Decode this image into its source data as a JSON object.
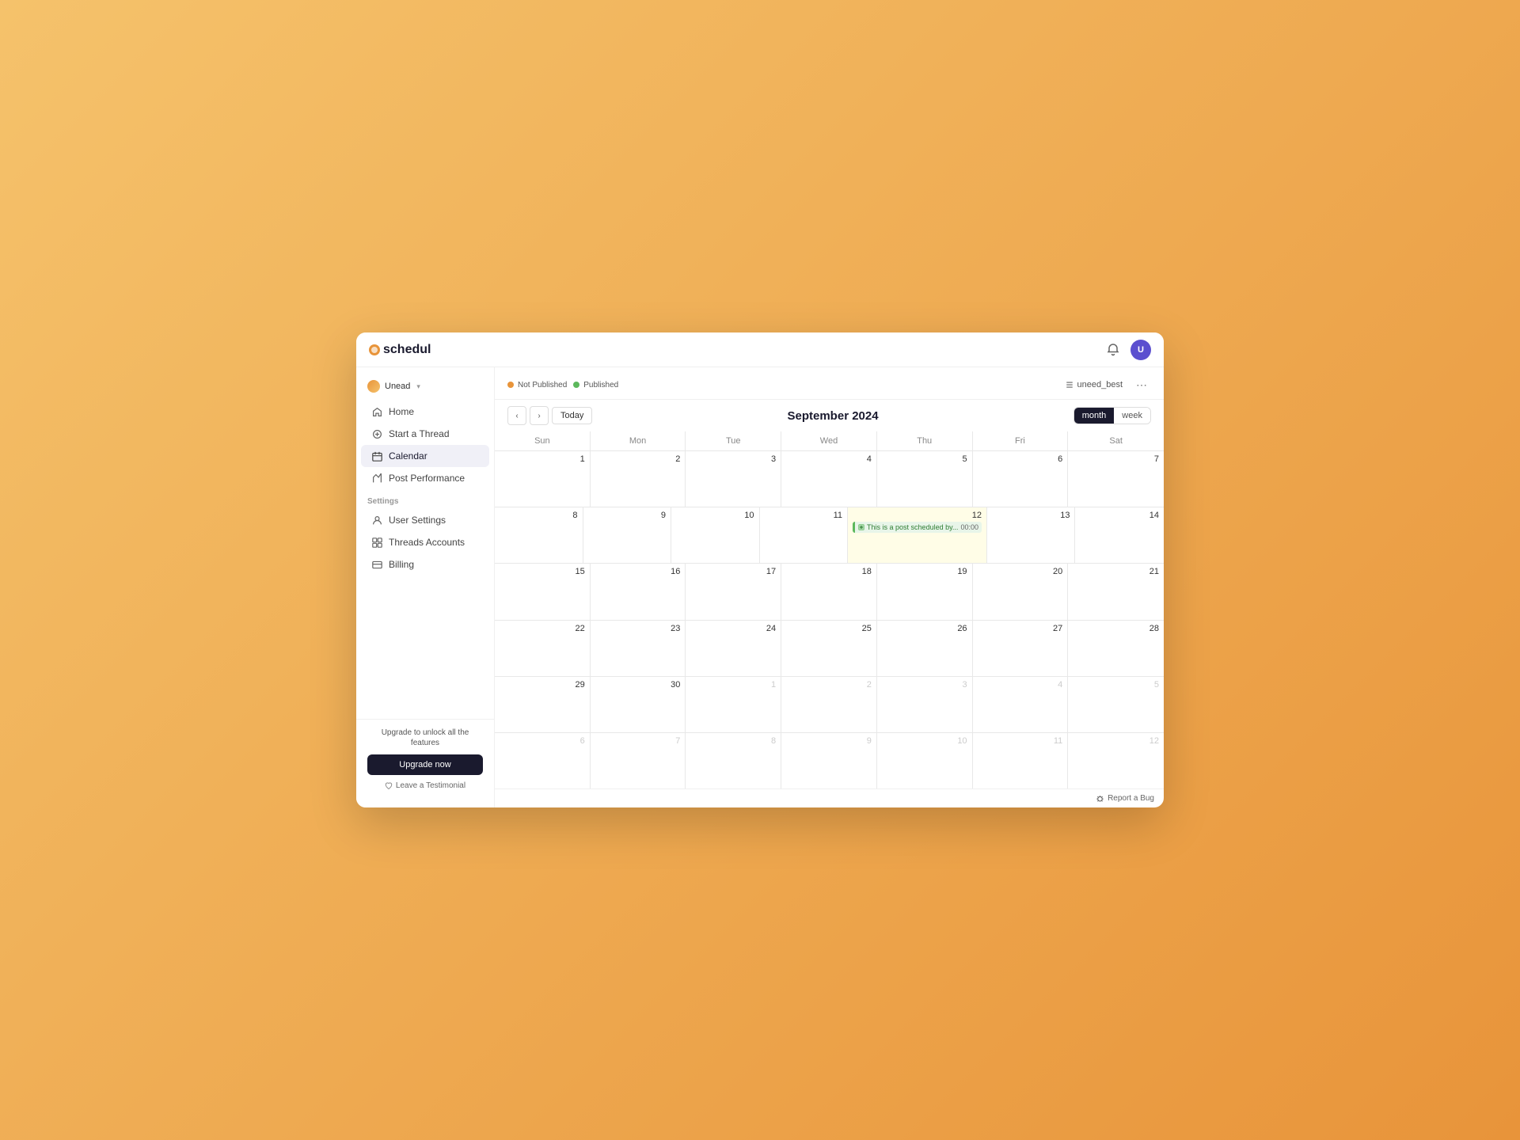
{
  "app": {
    "logo": "schedul",
    "logo_symbol": "©"
  },
  "topbar": {
    "bell_label": "🔔",
    "avatar_initials": "U"
  },
  "sidebar": {
    "account": {
      "name": "Unead",
      "dropdown": true
    },
    "nav_items": [
      {
        "id": "home",
        "label": "Home",
        "icon": "home"
      },
      {
        "id": "start-thread",
        "label": "Start a Thread",
        "icon": "plus"
      },
      {
        "id": "calendar",
        "label": "Calendar",
        "icon": "calendar",
        "active": true
      },
      {
        "id": "post-performance",
        "label": "Post Performance",
        "icon": "chart"
      }
    ],
    "settings_label": "Settings",
    "settings_items": [
      {
        "id": "user-settings",
        "label": "User Settings",
        "icon": "user"
      },
      {
        "id": "threads-accounts",
        "label": "Threads Accounts",
        "icon": "grid"
      },
      {
        "id": "billing",
        "label": "Billing",
        "icon": "credit-card"
      }
    ],
    "upgrade": {
      "text": "Upgrade to unlock all the features",
      "button_label": "Upgrade now"
    },
    "testimonial_label": "Leave a Testimonial"
  },
  "calendar": {
    "legend": {
      "not_published_label": "Not Published",
      "published_label": "Published"
    },
    "nav": {
      "prev_label": "‹",
      "next_label": "›",
      "today_label": "Today"
    },
    "title": "September 2024",
    "account_selector": "uneed_best",
    "view_buttons": [
      {
        "id": "month",
        "label": "month",
        "active": true
      },
      {
        "id": "week",
        "label": "week",
        "active": false
      }
    ],
    "weekdays": [
      "Sun",
      "Mon",
      "Tue",
      "Wed",
      "Thu",
      "Fri",
      "Sat"
    ],
    "weeks": [
      {
        "days": [
          {
            "num": "1",
            "other": false,
            "today": false,
            "highlighted": false,
            "events": []
          },
          {
            "num": "2",
            "other": false,
            "today": false,
            "highlighted": false,
            "events": []
          },
          {
            "num": "3",
            "other": false,
            "today": false,
            "highlighted": false,
            "events": []
          },
          {
            "num": "4",
            "other": false,
            "today": false,
            "highlighted": false,
            "events": []
          },
          {
            "num": "5",
            "other": false,
            "today": false,
            "highlighted": false,
            "events": []
          },
          {
            "num": "6",
            "other": false,
            "today": false,
            "highlighted": false,
            "events": []
          },
          {
            "num": "7",
            "other": false,
            "today": false,
            "highlighted": false,
            "events": []
          }
        ]
      },
      {
        "days": [
          {
            "num": "8",
            "other": false,
            "today": false,
            "highlighted": false,
            "events": []
          },
          {
            "num": "9",
            "other": false,
            "today": false,
            "highlighted": false,
            "events": []
          },
          {
            "num": "10",
            "other": false,
            "today": false,
            "highlighted": false,
            "events": []
          },
          {
            "num": "11",
            "other": false,
            "today": false,
            "highlighted": false,
            "events": []
          },
          {
            "num": "12",
            "other": false,
            "today": false,
            "highlighted": true,
            "events": [
              {
                "label": "This is a post scheduled by...",
                "time": "00:00",
                "type": "published"
              }
            ]
          },
          {
            "num": "13",
            "other": false,
            "today": false,
            "highlighted": false,
            "events": []
          },
          {
            "num": "14",
            "other": false,
            "today": false,
            "highlighted": false,
            "events": []
          }
        ]
      },
      {
        "days": [
          {
            "num": "15",
            "other": false,
            "today": false,
            "highlighted": false,
            "events": []
          },
          {
            "num": "16",
            "other": false,
            "today": false,
            "highlighted": false,
            "events": []
          },
          {
            "num": "17",
            "other": false,
            "today": false,
            "highlighted": false,
            "events": []
          },
          {
            "num": "18",
            "other": false,
            "today": false,
            "highlighted": false,
            "events": []
          },
          {
            "num": "19",
            "other": false,
            "today": false,
            "highlighted": false,
            "events": []
          },
          {
            "num": "20",
            "other": false,
            "today": false,
            "highlighted": false,
            "events": []
          },
          {
            "num": "21",
            "other": false,
            "today": false,
            "highlighted": false,
            "events": []
          }
        ]
      },
      {
        "days": [
          {
            "num": "22",
            "other": false,
            "today": false,
            "highlighted": false,
            "events": []
          },
          {
            "num": "23",
            "other": false,
            "today": false,
            "highlighted": false,
            "events": []
          },
          {
            "num": "24",
            "other": false,
            "today": false,
            "highlighted": false,
            "events": []
          },
          {
            "num": "25",
            "other": false,
            "today": false,
            "highlighted": false,
            "events": []
          },
          {
            "num": "26",
            "other": false,
            "today": false,
            "highlighted": false,
            "events": []
          },
          {
            "num": "27",
            "other": false,
            "today": false,
            "highlighted": false,
            "events": []
          },
          {
            "num": "28",
            "other": false,
            "today": false,
            "highlighted": false,
            "events": []
          }
        ]
      },
      {
        "days": [
          {
            "num": "29",
            "other": false,
            "today": false,
            "highlighted": false,
            "events": []
          },
          {
            "num": "30",
            "other": false,
            "today": false,
            "highlighted": false,
            "events": []
          },
          {
            "num": "1",
            "other": true,
            "today": false,
            "highlighted": false,
            "events": []
          },
          {
            "num": "2",
            "other": true,
            "today": false,
            "highlighted": false,
            "events": []
          },
          {
            "num": "3",
            "other": true,
            "today": false,
            "highlighted": false,
            "events": []
          },
          {
            "num": "4",
            "other": true,
            "today": false,
            "highlighted": false,
            "events": []
          },
          {
            "num": "5",
            "other": true,
            "today": false,
            "highlighted": false,
            "events": []
          }
        ]
      },
      {
        "days": [
          {
            "num": "6",
            "other": true,
            "today": false,
            "highlighted": false,
            "events": []
          },
          {
            "num": "7",
            "other": true,
            "today": false,
            "highlighted": false,
            "events": []
          },
          {
            "num": "8",
            "other": true,
            "today": false,
            "highlighted": false,
            "events": []
          },
          {
            "num": "9",
            "other": true,
            "today": false,
            "highlighted": false,
            "events": []
          },
          {
            "num": "10",
            "other": true,
            "today": false,
            "highlighted": false,
            "events": []
          },
          {
            "num": "11",
            "other": true,
            "today": false,
            "highlighted": false,
            "events": []
          },
          {
            "num": "12",
            "other": true,
            "today": false,
            "highlighted": false,
            "events": []
          }
        ]
      }
    ],
    "report_bug_label": "Report a Bug"
  }
}
